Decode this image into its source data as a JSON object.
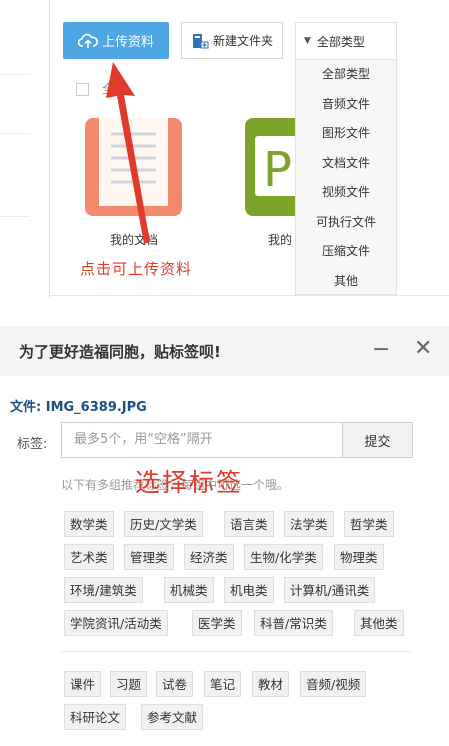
{
  "toolbar": {
    "upload_label": "上传资料",
    "new_folder_label": "新建文件夹",
    "type_filter_label": "全部类型"
  },
  "type_menu": [
    "全部类型",
    "音频文件",
    "图形文件",
    "文档文件",
    "视频文件",
    "可执行文件",
    "压缩文件",
    "其他"
  ],
  "file_list": {
    "select_all_label": "全",
    "files": [
      {
        "name": "我的文档",
        "icon": "document-file-icon"
      },
      {
        "name": "我的",
        "icon": "ppt-file-icon"
      }
    ]
  },
  "annotations": {
    "upload_hint": "点击可上传资料",
    "tag_hint": "选择标签"
  },
  "dialog": {
    "title": "为了更好造福同胞，贴标签呗!",
    "minimize_symbol": "−",
    "close_symbol": "✕",
    "file_label": "文件:",
    "file_name": "IMG_6389.JPG",
    "tag_label": "标签:",
    "tag_placeholder": "最多5个，用“空格”隔开",
    "submit_label": "提交",
    "hint_text": "以下有多组推荐标签，每组中可选一个哦。",
    "subject_tags": [
      [
        "数学类",
        "历史/文学类",
        "语言类",
        "法学类",
        "哲学类"
      ],
      [
        "艺术类",
        "管理类",
        "经济类",
        "生物/化学类",
        "物理类"
      ],
      [
        "环境/建筑类",
        "机械类",
        "机电类",
        "计算机/通讯类"
      ],
      [
        "学院资讯/活动类",
        "医学类",
        "科普/常识类",
        "其他类"
      ]
    ],
    "type_tags": [
      [
        "课件",
        "习题",
        "试卷",
        "笔记",
        "教材",
        "音频/视频"
      ],
      [
        "科研论文",
        "参考文献"
      ]
    ]
  },
  "colors": {
    "upload_button": "#4fa6e4",
    "annotation_red": "#e13a2a",
    "doc_icon": "#f4896e",
    "ppt_icon": "#7ba428",
    "file_label": "#1d4f86"
  }
}
